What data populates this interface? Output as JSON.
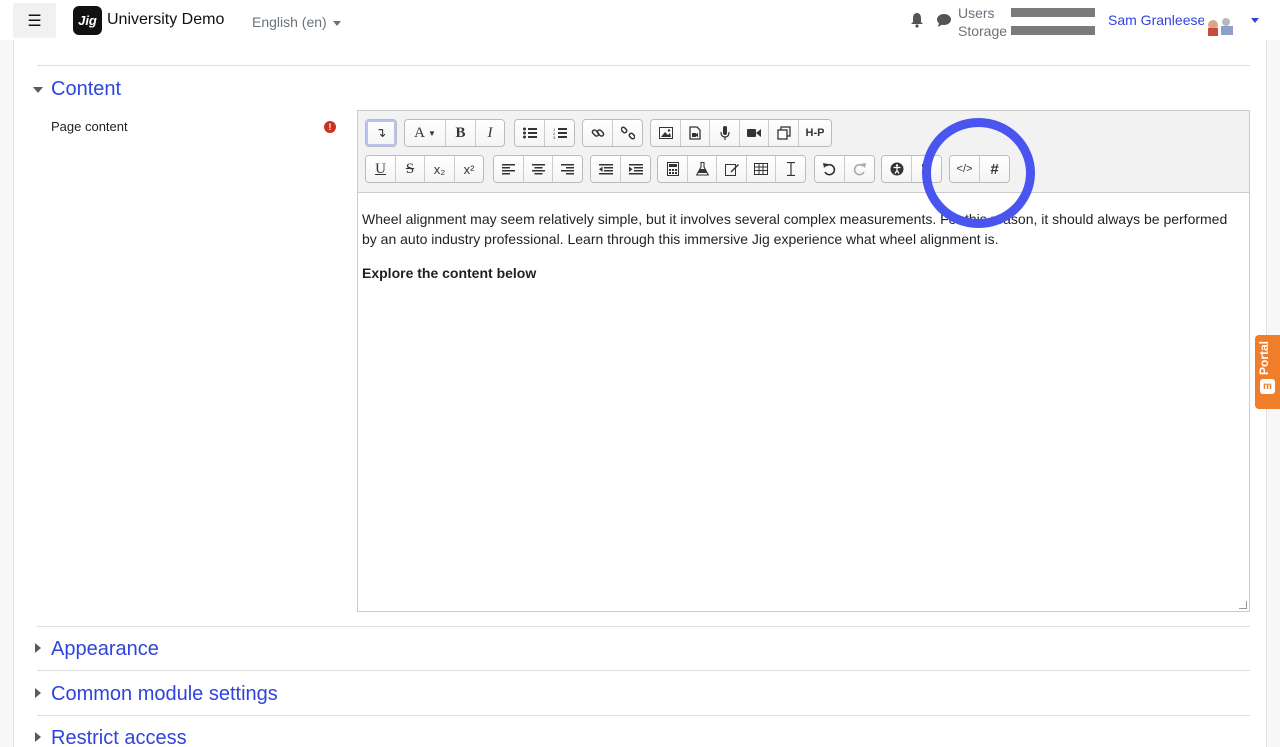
{
  "navbar": {
    "menu_icon": "hamburger-icon",
    "logo_text": "Jig",
    "site_name": "University Demo",
    "language": "English ‎(en)‎",
    "usage_users_label": "Users",
    "usage_storage_label": "Storage",
    "user_name": "Sam Granleese"
  },
  "sections": {
    "content_title": "Content",
    "appearance_title": "Appearance",
    "common_title": "Common module settings",
    "restrict_title": "Restrict access"
  },
  "field": {
    "label": "Page content",
    "required_icon": "exclamation-icon"
  },
  "toolbar": {
    "row1": [
      "↴",
      "A▾",
      "B",
      "I",
      "list-bullet",
      "list-number",
      "link",
      "unlink",
      "image",
      "media",
      "record-audio",
      "record-video",
      "manage-files",
      "H-P"
    ],
    "h5p_label": "H‑P",
    "font_label": "A",
    "bold_label": "B",
    "italic_label": "I",
    "underline_label": "U",
    "strike_label": "S",
    "sub_label": "x₂",
    "sup_label": "x²",
    "html_label": "</>",
    "hash_label": "#",
    "expand_label": "↴"
  },
  "editor": {
    "paragraph": "Wheel alignment may seem relatively simple, but it involves several complex measurements. For this reason, it should always be performed by an auto industry professional. Learn through this immersive Jig experience what wheel alignment is.",
    "heading": "Explore the content below"
  },
  "portal": {
    "label": "Portal",
    "icon_text": "m"
  },
  "colors": {
    "link": "#2f44de",
    "highlight": "#4a55f0",
    "portal": "#f07d2a",
    "required": "#ca3120"
  }
}
